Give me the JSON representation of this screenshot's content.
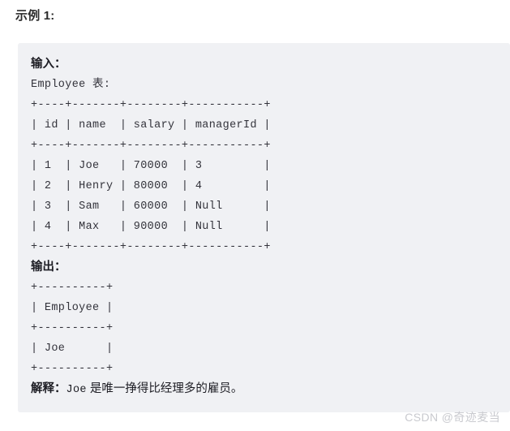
{
  "heading": "示例 1:",
  "code_block": {
    "input_label": "输入：",
    "table_caption": "Employee 表:",
    "input_table": {
      "separator": "+----+-------+--------+-----------+",
      "header_row": "| id | name  | salary | managerId |",
      "rows": [
        "| 1  | Joe   | 70000  | 3         |",
        "| 2  | Henry | 80000  | 4         |",
        "| 3  | Sam   | 60000  | Null      |",
        "| 4  | Max   | 90000  | Null      |"
      ],
      "columns": [
        "id",
        "name",
        "salary",
        "managerId"
      ],
      "data": [
        {
          "id": "1",
          "name": "Joe",
          "salary": "70000",
          "managerId": "3"
        },
        {
          "id": "2",
          "name": "Henry",
          "salary": "80000",
          "managerId": "4"
        },
        {
          "id": "3",
          "name": "Sam",
          "salary": "60000",
          "managerId": "Null"
        },
        {
          "id": "4",
          "name": "Max",
          "salary": "90000",
          "managerId": "Null"
        }
      ]
    },
    "output_label": "输出：",
    "output_table": {
      "separator": "+----------+",
      "header_row": "| Employee |",
      "rows": [
        "| Joe      |"
      ],
      "columns": [
        "Employee"
      ],
      "data": [
        {
          "Employee": "Joe"
        }
      ]
    },
    "explanation": {
      "label": "解释：",
      "subject": "Joe",
      "text": " 是唯一挣得比经理多的雇员。"
    }
  },
  "watermark": "CSDN @奇迹麦当"
}
